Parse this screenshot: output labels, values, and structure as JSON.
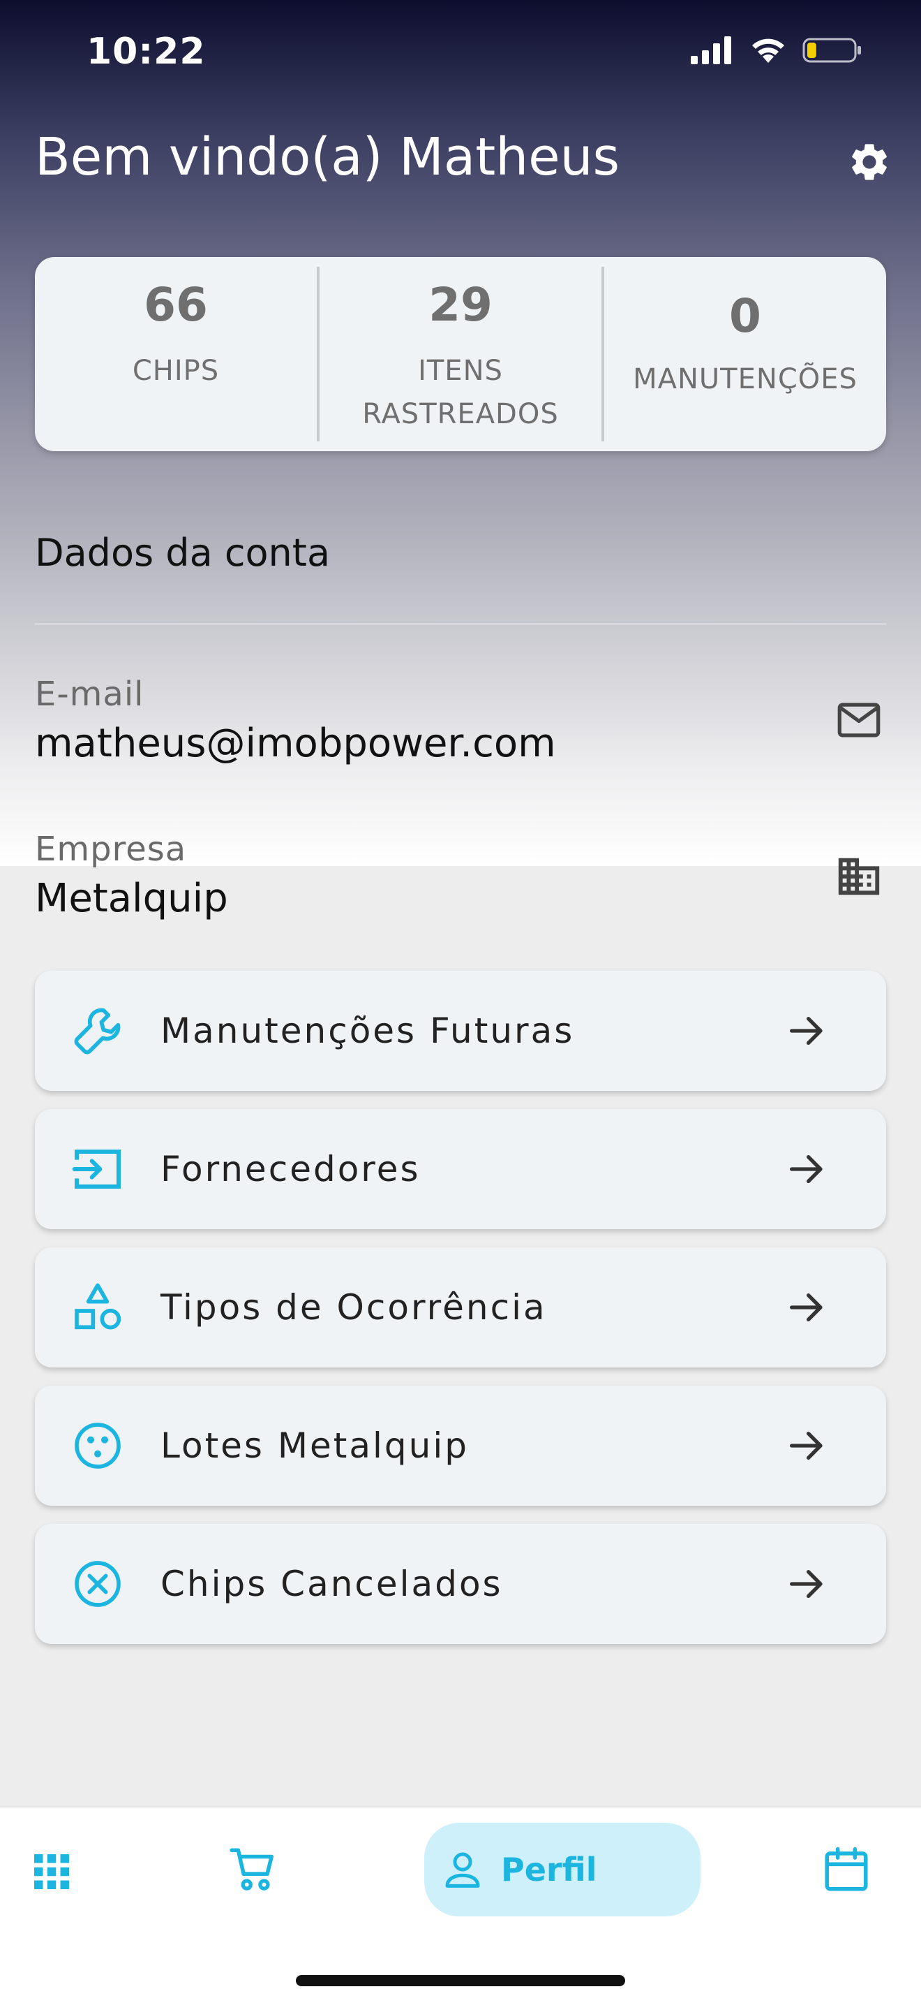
{
  "status_bar": {
    "time": "10:22",
    "battery_level": 0.2
  },
  "header": {
    "welcome": "Bem vindo(a) Matheus",
    "settings_icon": "gear-icon"
  },
  "stats": [
    {
      "value": "66",
      "label": "CHIPS"
    },
    {
      "value": "29",
      "label": "ITENS",
      "label2": "RASTREADOS"
    },
    {
      "value": "0",
      "label": "MANUTENÇÕES"
    }
  ],
  "account": {
    "title": "Dados da conta",
    "email_label": "E-mail",
    "email_value": "matheus@imobpower.com",
    "company_label": "Empresa",
    "company_value": "Metalquip"
  },
  "menu": [
    {
      "label": "Manutenções Futuras",
      "icon": "wrench-icon"
    },
    {
      "label": "Fornecedores",
      "icon": "login-icon"
    },
    {
      "label": "Tipos de Ocorrência",
      "icon": "shapes-icon"
    },
    {
      "label": "Lotes Metalquip",
      "icon": "cookie-icon"
    },
    {
      "label": "Chips Cancelados",
      "icon": "cancel-circle-icon"
    }
  ],
  "bottom_nav": {
    "active_label": "Perfil",
    "items": [
      "grid-icon",
      "cart-icon",
      "person-icon",
      "calendar-icon"
    ]
  },
  "colors": {
    "accent": "#1cb5e0",
    "card": "#eff3f6",
    "active_pill": "#cdf0fb"
  }
}
